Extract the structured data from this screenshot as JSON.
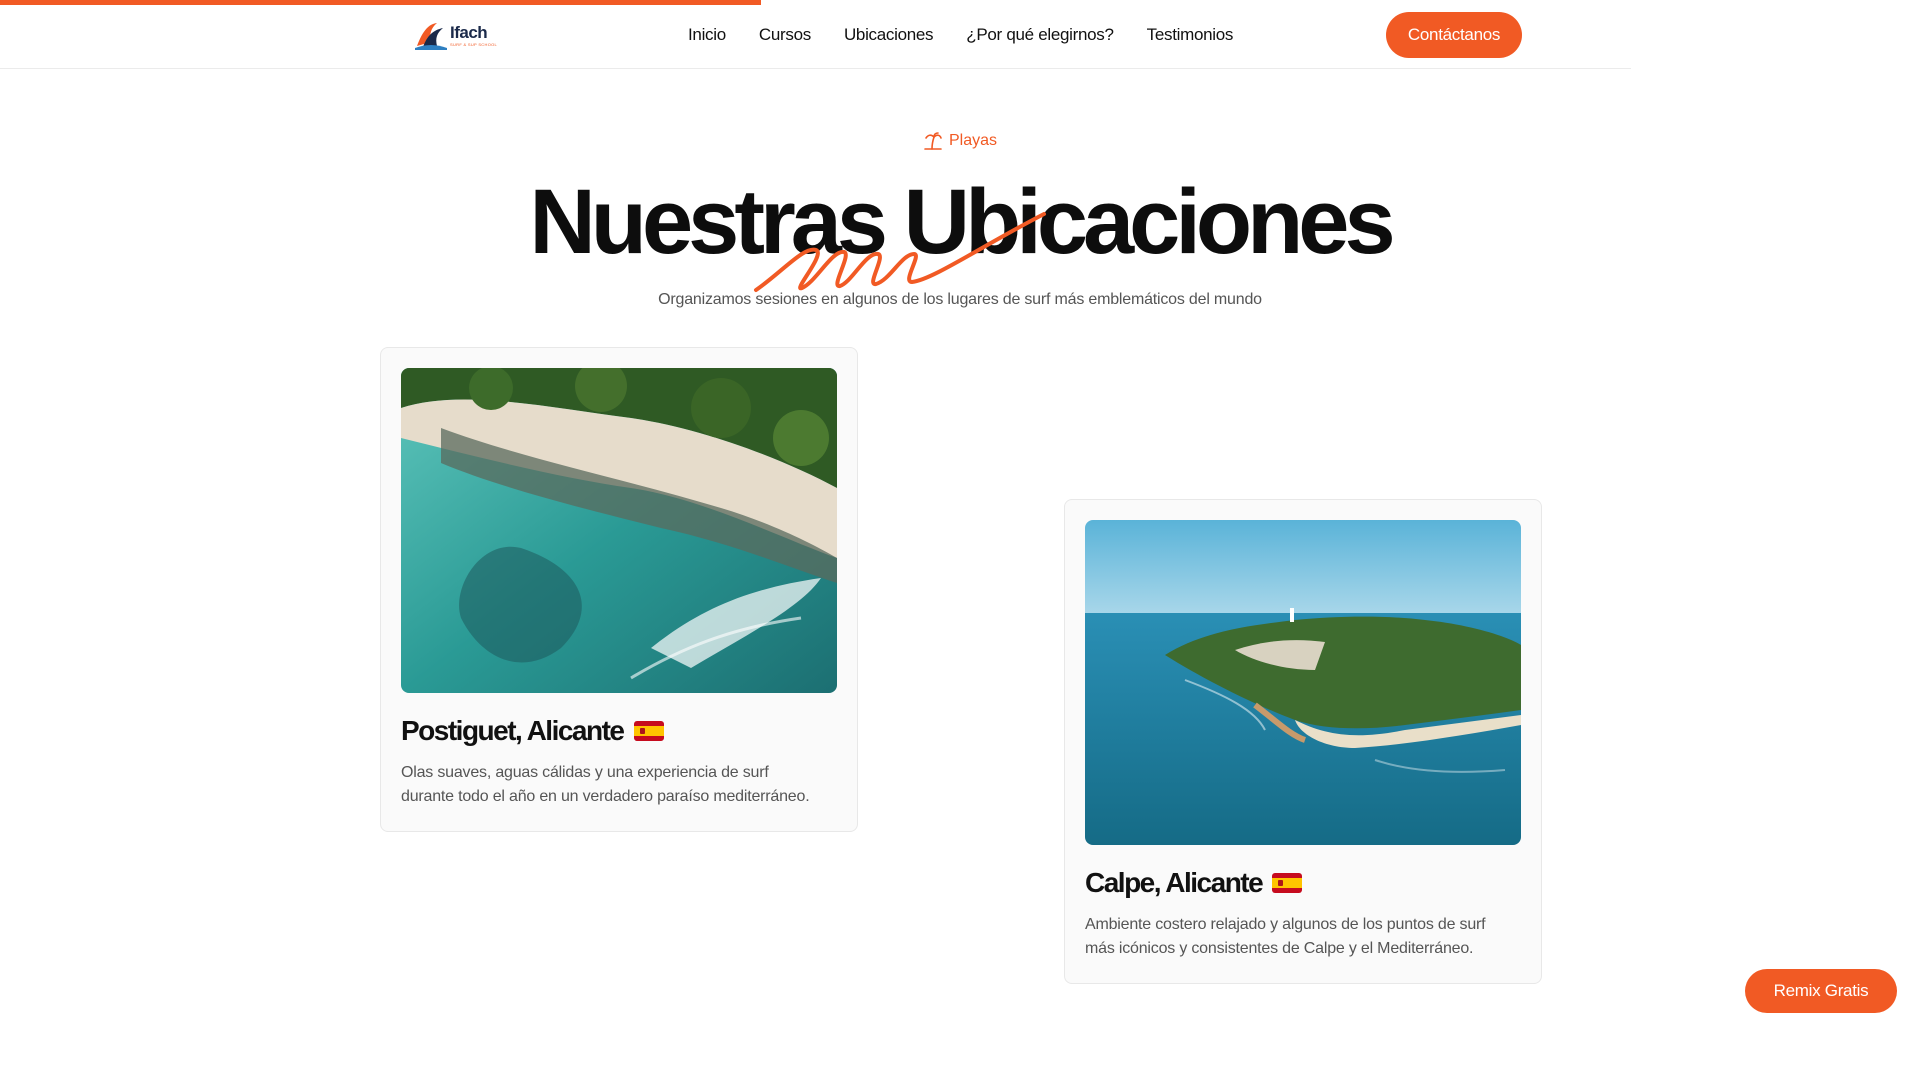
{
  "header": {
    "logo": {
      "name": "Ifach",
      "sub": "SURF & SUP SCHOOL"
    },
    "nav": [
      "Inicio",
      "Cursos",
      "Ubicaciones",
      "¿Por qué elegirnos?",
      "Testimonios"
    ],
    "cta_label": "Contáctanos"
  },
  "section": {
    "eyebrow": "Playas",
    "eyebrow_icon": "palm-tree-icon",
    "title": "Nuestras Ubicaciones",
    "subtitle": "Organizamos sesiones en algunos de los lugares de surf más emblemáticos del mundo"
  },
  "locations": [
    {
      "name": "Postiguet, Alicante",
      "flag_icon": "spain-flag-icon",
      "description_line1": "Olas suaves, aguas cálidas y una experiencia de surf",
      "description_line2": "durante todo el año en un verdadero paraíso mediterráneo."
    },
    {
      "name": "Calpe, Alicante",
      "flag_icon": "spain-flag-icon",
      "description_line1": "Ambiente costero relajado y algunos de los puntos de surf",
      "description_line2": "más icónicos y consistentes de Calpe y el Mediterráneo."
    }
  ],
  "floating": {
    "remix_label": "Remix Gratis"
  },
  "colors": {
    "accent": "#f15a24",
    "text": "#111111",
    "muted": "#555555"
  }
}
